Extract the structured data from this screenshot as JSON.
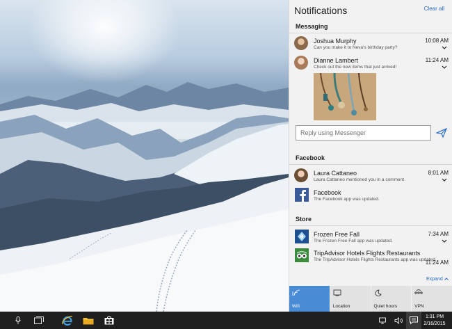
{
  "action_center": {
    "title": "Notifications",
    "clear_all": "Clear all",
    "expand": "Expand",
    "reply_placeholder": "Reply using Messenger"
  },
  "groups": {
    "messaging": {
      "header": "Messaging",
      "items": [
        {
          "sender": "Joshua Murphy",
          "text": "Can you make it to Neva's birthday party?",
          "time": "10:08 AM"
        },
        {
          "sender": "Dianne Lambert",
          "text": "Check out the new items that just arrived!",
          "time": "11:24 AM"
        }
      ]
    },
    "facebook": {
      "header": "Facebook",
      "items": [
        {
          "sender": "Laura Cattaneo",
          "text": "Laura Cattaneo mentioned you in a comment.",
          "time": "8:01 AM"
        },
        {
          "sender": "Facebook",
          "text": "The Facebook app was updated."
        }
      ]
    },
    "store": {
      "header": "Store",
      "items": [
        {
          "sender": "Frozen Free Fall",
          "text": "The Frozen Free Fall app was updated.",
          "time": "7:34 AM"
        },
        {
          "sender": "TripAdvisor Hotels Flights Restaurants",
          "text": "The TripAdvisor Hotels Flights Restaurants app was updated.",
          "time": "11:24 AM"
        }
      ]
    }
  },
  "quick_actions": [
    {
      "label": "Wifi",
      "icon": "wifi-icon",
      "active": true
    },
    {
      "label": "Location",
      "icon": "location-icon",
      "active": false
    },
    {
      "label": "Quiet hours",
      "icon": "moon-icon",
      "active": false
    },
    {
      "label": "VPN",
      "icon": "vpn-icon",
      "active": false
    }
  ],
  "taskbar": {
    "time": "1:31 PM",
    "date": "2/16/2015"
  },
  "colors": {
    "accent": "#4a8bd6",
    "link": "#2b6cc4",
    "panel_bg": "#f2f2f2",
    "taskbar_bg": "#1f1f1f"
  }
}
